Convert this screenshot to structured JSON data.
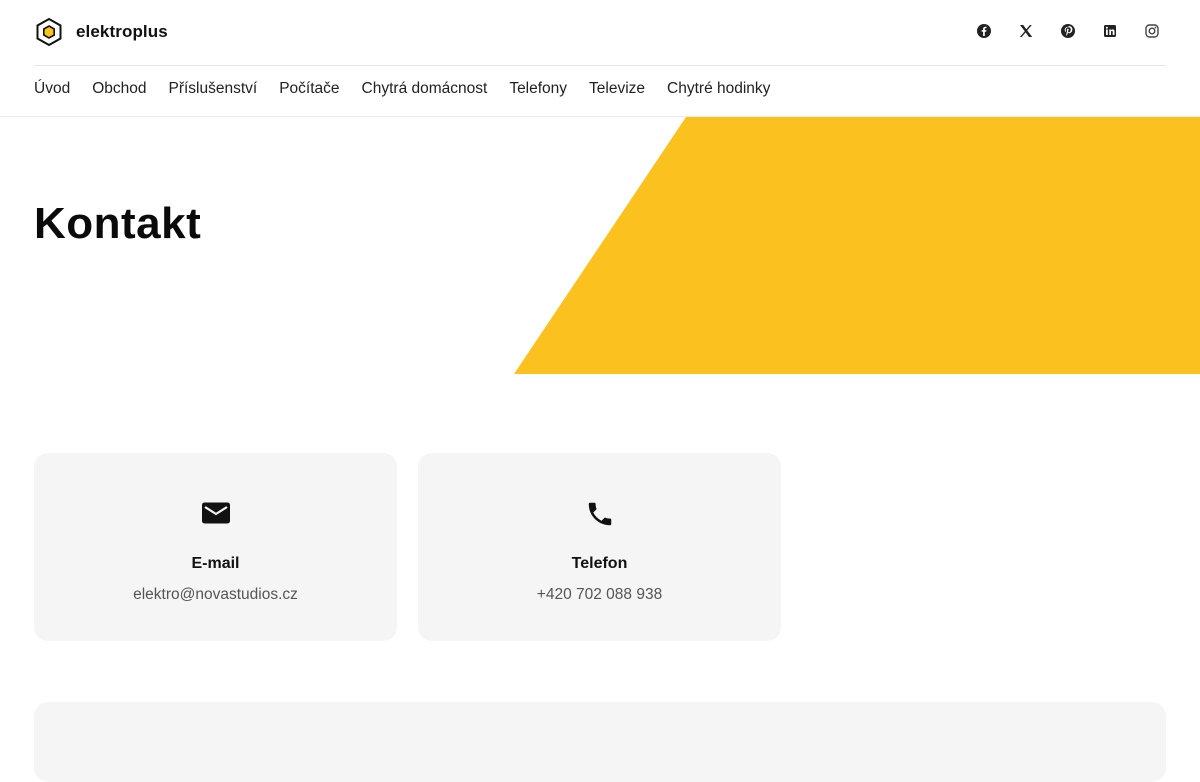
{
  "brand": {
    "name": "elektroplus",
    "icon": "hexagon-logo-icon",
    "accent": "#fbc21f"
  },
  "social": [
    {
      "name": "facebook-icon"
    },
    {
      "name": "x-icon"
    },
    {
      "name": "pinterest-icon"
    },
    {
      "name": "linkedin-icon"
    },
    {
      "name": "instagram-icon"
    }
  ],
  "nav": {
    "items": [
      {
        "label": "Úvod"
      },
      {
        "label": "Obchod"
      },
      {
        "label": "Příslušenství"
      },
      {
        "label": "Počítače"
      },
      {
        "label": "Chytrá domácnost"
      },
      {
        "label": "Telefony"
      },
      {
        "label": "Televize"
      },
      {
        "label": "Chytré hodinky"
      }
    ]
  },
  "hero": {
    "title": "Kontakt",
    "shape_color": "#fbc21f"
  },
  "contacts": {
    "email": {
      "icon": "mail-icon",
      "label": "E-mail",
      "value": "elektro@novastudios.cz"
    },
    "phone": {
      "icon": "phone-icon",
      "label": "Telefon",
      "value": "+420 702 088 938"
    }
  }
}
